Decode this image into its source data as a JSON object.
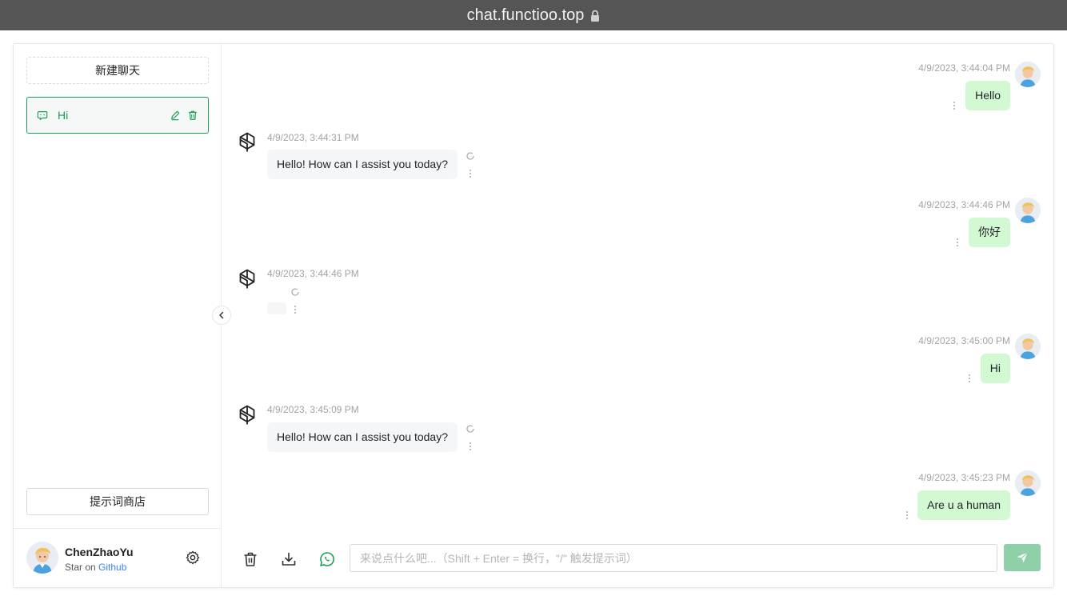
{
  "browser": {
    "url": "chat.functioo.top"
  },
  "sidebar": {
    "new_chat_label": "新建聊天",
    "chats": [
      {
        "title": "Hi"
      }
    ],
    "prompt_store_label": "提示词商店",
    "user": {
      "name": "ChenZhaoYu",
      "sub_prefix": "Star on",
      "sub_link": "Github"
    }
  },
  "messages": [
    {
      "role": "user",
      "time": "4/9/2023, 3:44:04 PM",
      "text": "Hello"
    },
    {
      "role": "assistant",
      "time": "4/9/2023, 3:44:31 PM",
      "text": "Hello! How can I assist you today?"
    },
    {
      "role": "user",
      "time": "4/9/2023, 3:44:46 PM",
      "text": "你好"
    },
    {
      "role": "assistant",
      "time": "4/9/2023, 3:44:46 PM",
      "text": ""
    },
    {
      "role": "user",
      "time": "4/9/2023, 3:45:00 PM",
      "text": "Hi"
    },
    {
      "role": "assistant",
      "time": "4/9/2023, 3:45:09 PM",
      "text": "Hello! How can I assist you today?"
    },
    {
      "role": "user",
      "time": "4/9/2023, 3:45:23 PM",
      "text": "Are u a human"
    }
  ],
  "input": {
    "placeholder": "来说点什么吧...（Shift + Enter = 换行，\"/\" 触发提示词）",
    "value": ""
  },
  "colors": {
    "accent": "#18a058",
    "user_bubble": "#d2f9d1",
    "bot_bubble": "#f4f6f8",
    "send_button": "#8fd0a8"
  },
  "icons": {
    "lock": "lock-icon",
    "message": "message-icon",
    "edit": "edit-icon",
    "delete": "trash-icon",
    "settings": "gear-icon",
    "collapse": "chevron-left-icon",
    "clear": "trash-icon",
    "download": "download-icon",
    "context": "whatsapp-icon",
    "send": "send-icon",
    "more": "more-vertical-icon",
    "bot": "openai-logo-icon",
    "refresh": "refresh-icon"
  }
}
